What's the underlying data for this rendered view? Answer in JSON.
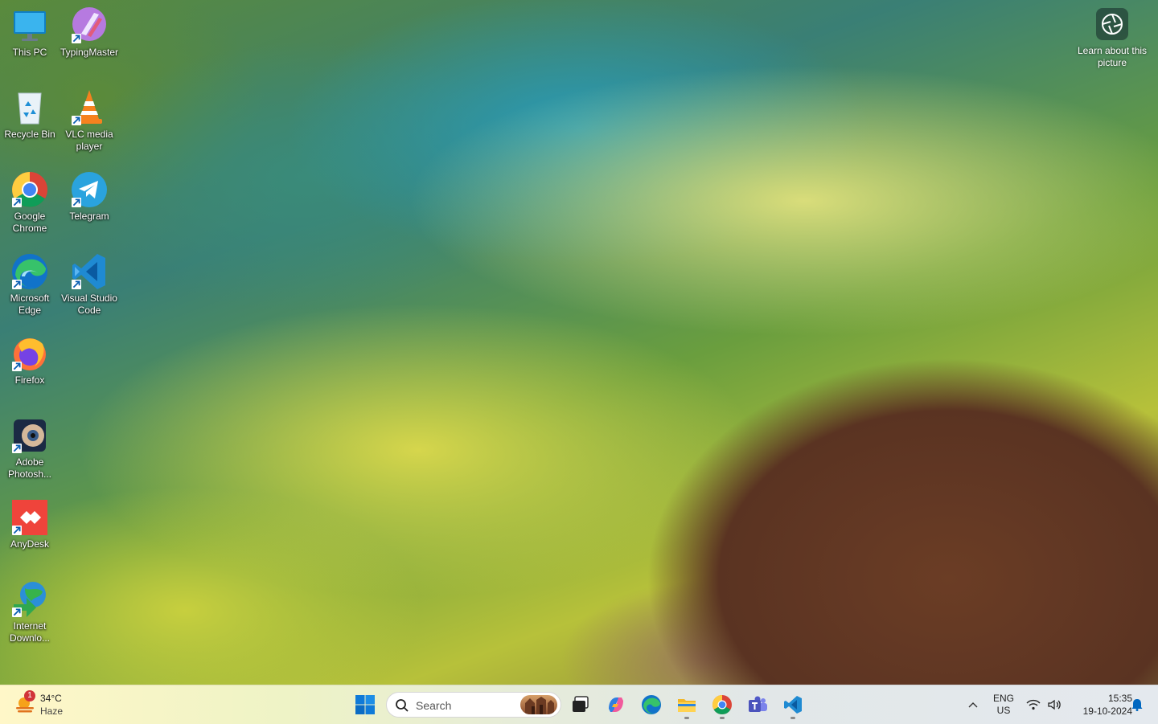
{
  "desktop": {
    "icons": [
      {
        "id": "this-pc",
        "label": "This PC"
      },
      {
        "id": "typingmaster",
        "label": "TypingMaster"
      },
      {
        "id": "recycle-bin",
        "label": "Recycle Bin"
      },
      {
        "id": "vlc",
        "label": "VLC media player"
      },
      {
        "id": "chrome",
        "label": "Google Chrome"
      },
      {
        "id": "telegram",
        "label": "Telegram"
      },
      {
        "id": "edge",
        "label": "Microsoft Edge"
      },
      {
        "id": "vscode",
        "label": "Visual Studio Code"
      },
      {
        "id": "firefox",
        "label": "Firefox"
      },
      {
        "id": "photoshop",
        "label": "Adobe Photosh..."
      },
      {
        "id": "anydesk",
        "label": "AnyDesk"
      },
      {
        "id": "idm",
        "label": "Internet Downlo..."
      }
    ],
    "learn_label": "Learn about this picture"
  },
  "taskbar": {
    "weather": {
      "temp": "34°C",
      "desc": "Haze",
      "badge": "1"
    },
    "search_placeholder": "Search",
    "apps": [
      {
        "id": "start",
        "icon": "windows-icon",
        "running": false
      },
      {
        "id": "task-view",
        "icon": "task-view-icon",
        "running": false
      },
      {
        "id": "copilot",
        "icon": "copilot-icon",
        "running": false
      },
      {
        "id": "edge",
        "icon": "edge-icon",
        "running": false
      },
      {
        "id": "file-explorer",
        "icon": "folder-icon",
        "running": true
      },
      {
        "id": "chrome",
        "icon": "chrome-icon",
        "running": true
      },
      {
        "id": "teams",
        "icon": "teams-icon",
        "running": false
      },
      {
        "id": "vscode",
        "icon": "vscode-icon",
        "running": true
      }
    ],
    "language": {
      "line1": "ENG",
      "line2": "US"
    },
    "clock": {
      "time": "15:35",
      "date": "19-10-2024"
    }
  },
  "colors": {
    "accent": "#0067c0",
    "badge": "#d13438"
  }
}
